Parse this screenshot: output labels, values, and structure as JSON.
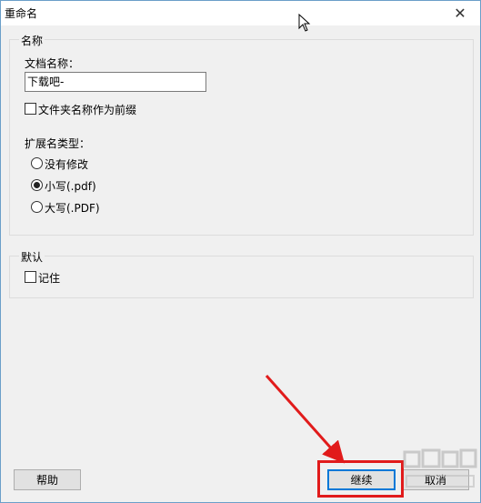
{
  "window": {
    "title": "重命名",
    "close_label": "✕"
  },
  "name_group": {
    "legend": "名称",
    "doc_name_label": "文档名称：",
    "doc_name_value": "下载吧-",
    "folder_prefix_label": "文件夹名称作为前缀",
    "folder_prefix_checked": false
  },
  "ext_group": {
    "label": "扩展名类型：",
    "options": [
      {
        "label": "没有修改",
        "checked": false
      },
      {
        "label": "小写(.pdf)",
        "checked": true
      },
      {
        "label": "大写(.PDF)",
        "checked": false
      }
    ]
  },
  "default_group": {
    "legend": "默认",
    "remember_label": "记住",
    "remember_checked": false
  },
  "buttons": {
    "help": "帮助",
    "continue": "继续",
    "cancel": "取消"
  },
  "annotation": {
    "highlight_color": "#e11b1b"
  }
}
